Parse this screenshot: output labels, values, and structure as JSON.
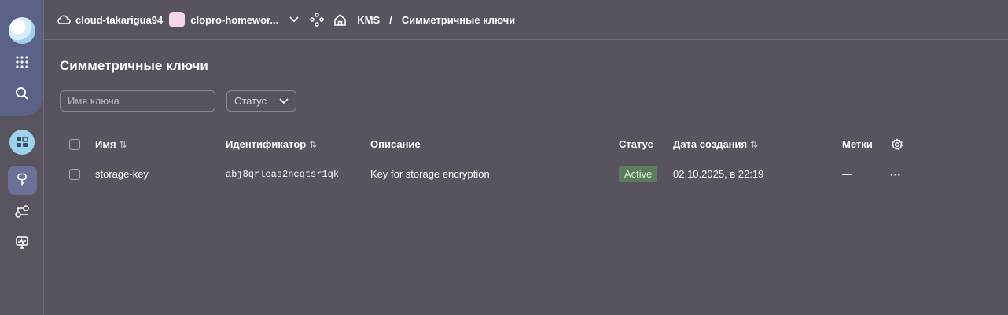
{
  "header": {
    "cloud_name": "cloud-takarigua94",
    "folder_name": "clopro-homewor...",
    "service": "KMS",
    "separator": "/",
    "current_page": "Симметричные ключи"
  },
  "page": {
    "title": "Симметричные ключи"
  },
  "filters": {
    "search_placeholder": "Имя ключа",
    "search_value": "",
    "status_label": "Статус"
  },
  "table": {
    "columns": {
      "name": "Имя",
      "id": "Идентификатор",
      "description": "Описание",
      "status": "Статус",
      "created": "Дата создания",
      "labels": "Метки"
    },
    "sort_glyph": "⇅",
    "rows": [
      {
        "name": "storage-key",
        "id": "abj8qrleas2ncqtsr1qk",
        "description": "Key for storage encryption",
        "status": "Active",
        "created": "02.10.2025, в 22:19",
        "labels": "—",
        "menu": "···"
      }
    ]
  },
  "colors": {
    "background": "#58545f",
    "sidebar_accent": "#5c6187",
    "active_badge": "#5b7d5c"
  }
}
